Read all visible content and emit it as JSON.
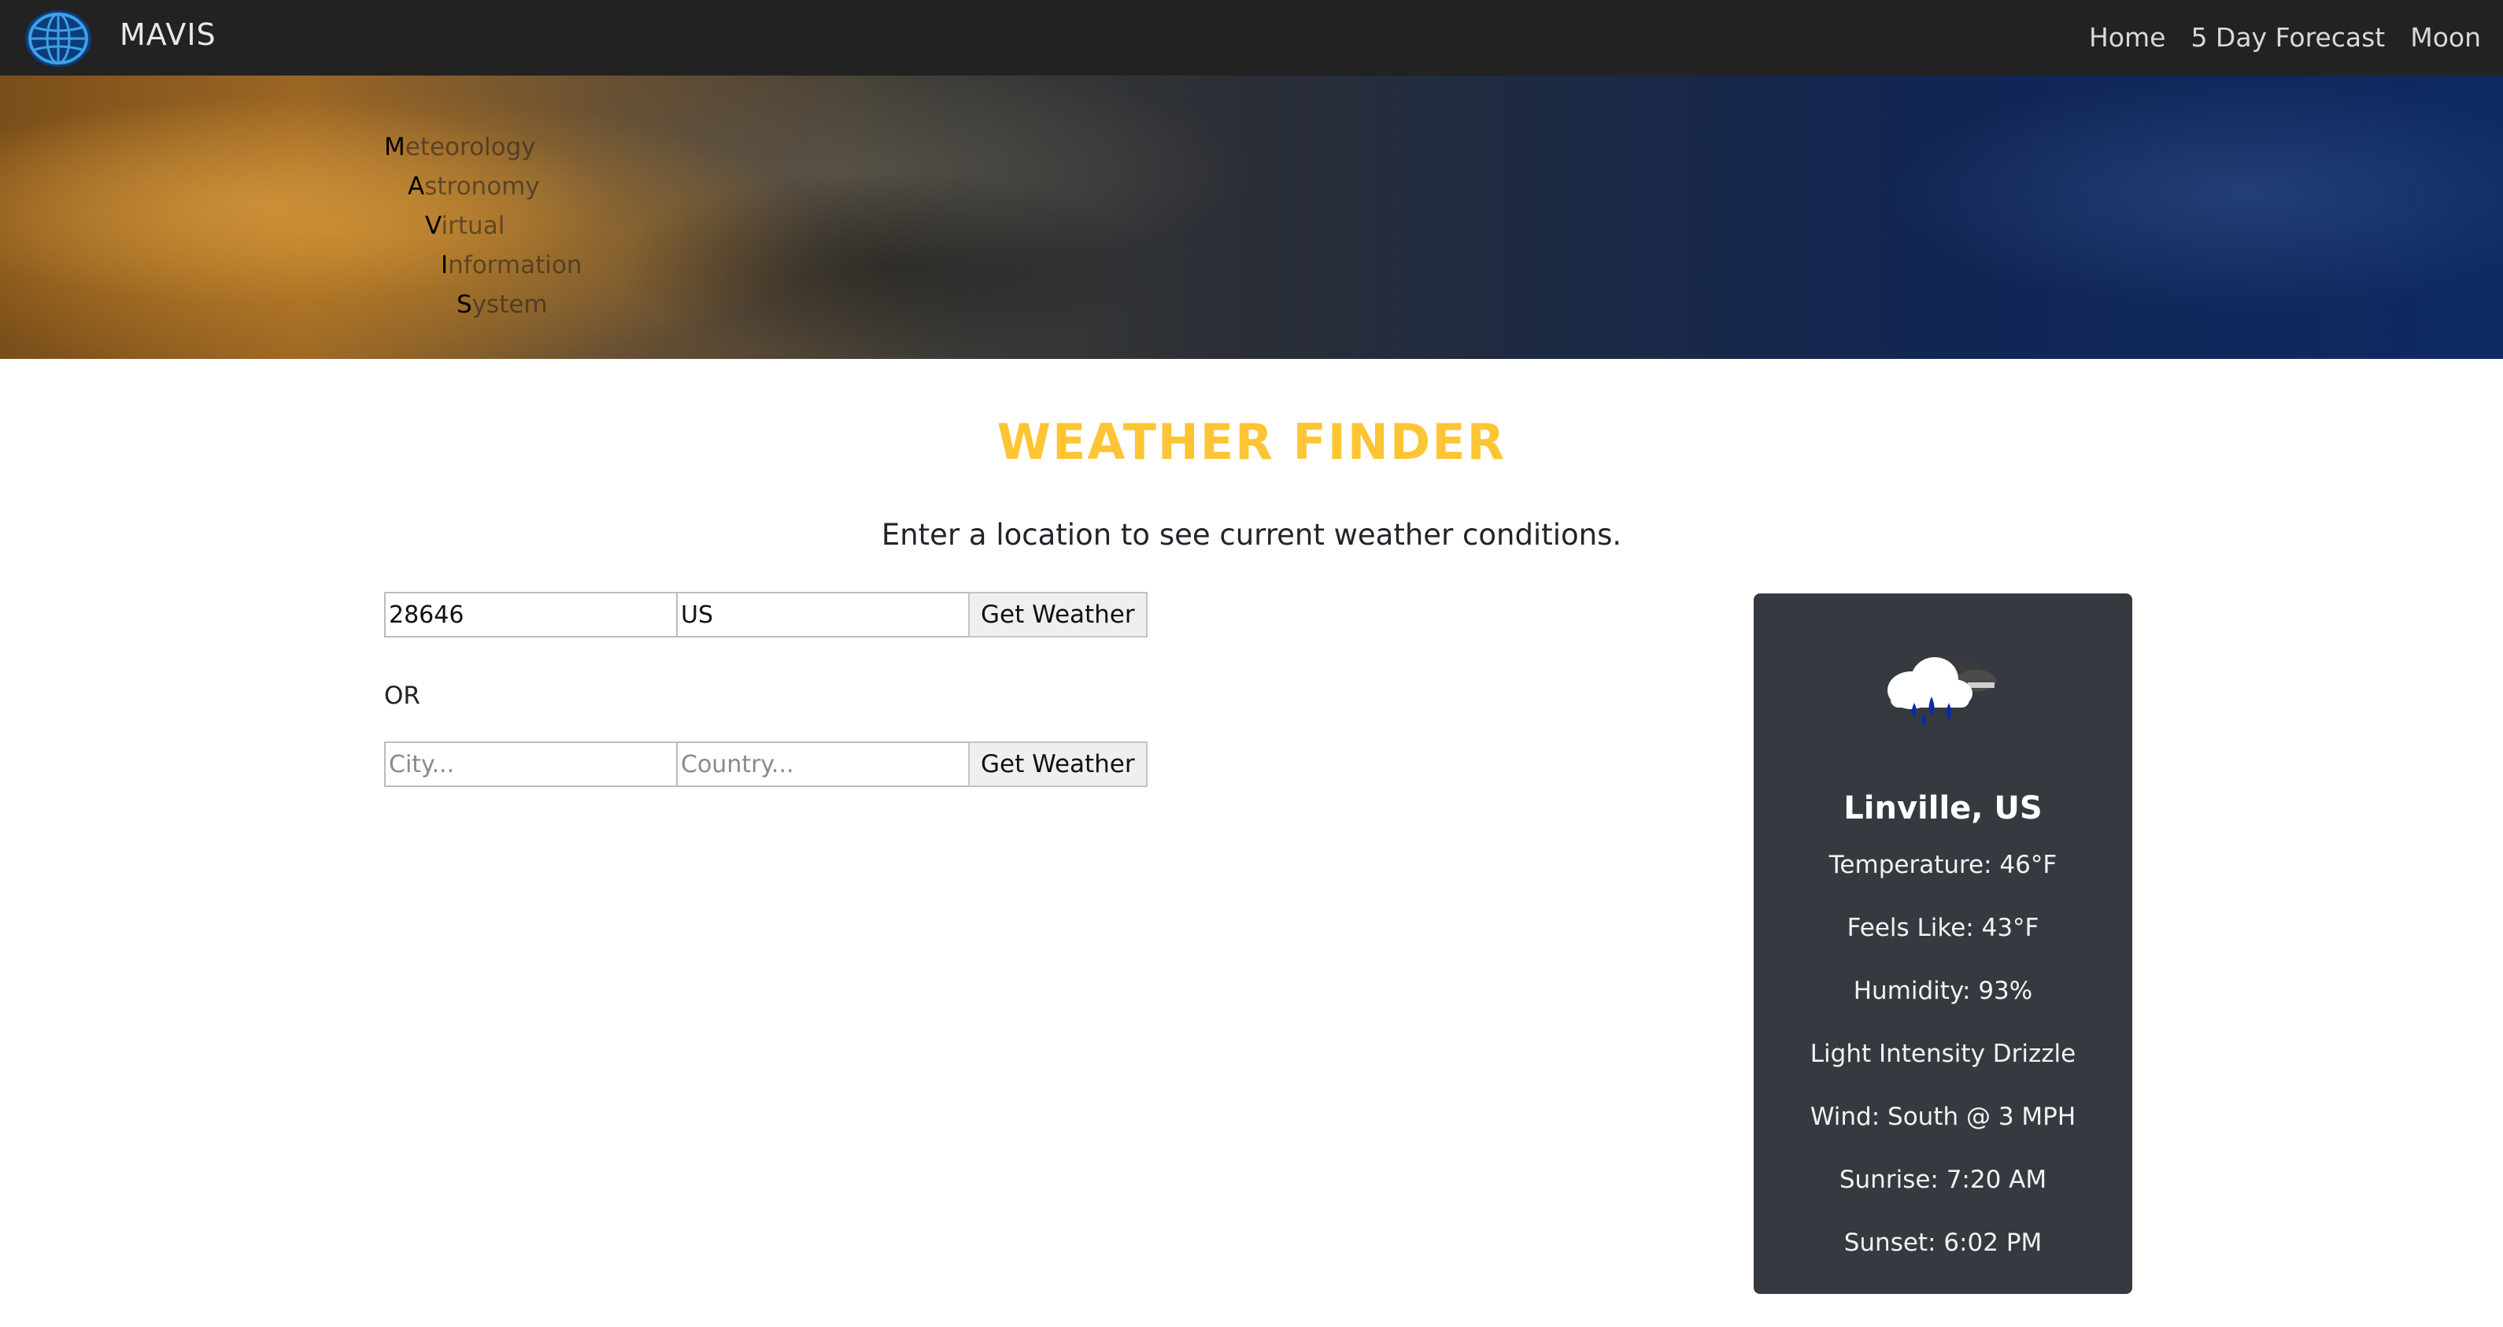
{
  "navbar": {
    "brand": "MAVIS",
    "links": [
      "Home",
      "5 Day Forecast",
      "Moon"
    ]
  },
  "hero": {
    "acronym": [
      {
        "letter": "M",
        "rest": "eteorology"
      },
      {
        "letter": "A",
        "rest": "stronomy"
      },
      {
        "letter": "V",
        "rest": "irtual"
      },
      {
        "letter": "I",
        "rest": "nformation"
      },
      {
        "letter": "S",
        "rest": "ystem"
      }
    ]
  },
  "main": {
    "title": "WEATHER FINDER",
    "subtitle": "Enter a location to see current weather conditions.",
    "zip_form": {
      "zip_value": "28646",
      "country_value": "US",
      "button": "Get Weather"
    },
    "or_label": "OR",
    "city_form": {
      "city_placeholder": "City...",
      "country_placeholder": "Country...",
      "button": "Get Weather"
    }
  },
  "weather": {
    "icon": "rain-cloud-icon",
    "location": "Linville, US",
    "temperature": "Temperature: 46°F",
    "feels_like": "Feels Like: 43°F",
    "humidity": "Humidity: 93%",
    "description": "Light Intensity Drizzle",
    "wind": "Wind: South @ 3 MPH",
    "sunrise": "Sunrise: 7:20 AM",
    "sunset": "Sunset: 6:02 PM"
  },
  "colors": {
    "navbar": "#222222",
    "title": "#fdc534",
    "card": "#343a40"
  }
}
